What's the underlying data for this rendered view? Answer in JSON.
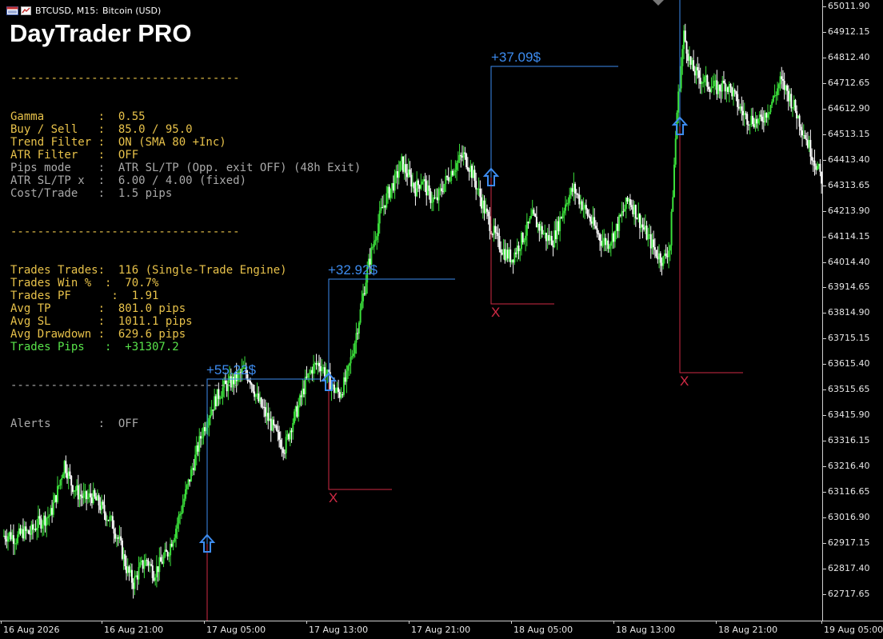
{
  "window": {
    "symbol": "BTCUSD, M15:",
    "description": "Bitcoin (USD)"
  },
  "panel": {
    "title": "DayTrader PRO",
    "separator": "----------------------------------",
    "rows_a": [
      {
        "key": "gamma",
        "text": "Gamma        :  0.55",
        "color": "yellow"
      },
      {
        "key": "buy-sell",
        "text": "Buy / Sell   :  85.0 / 95.0",
        "color": "yellow"
      },
      {
        "key": "trend-filter",
        "text": "Trend Filter :  ON (SMA 80 +Inc)",
        "color": "yellow"
      },
      {
        "key": "atr-filter",
        "text": "ATR Filter   :  OFF",
        "color": "yellow"
      },
      {
        "key": "pips-mode",
        "text": "Pips mode    :  ATR SL/TP (Opp. exit OFF) (48h Exit)",
        "color": "gray"
      },
      {
        "key": "atr-sltp",
        "text": "ATR SL/TP x  :  6.00 / 4.00 (fixed)",
        "color": "gray"
      },
      {
        "key": "cost-trade",
        "text": "Cost/Trade   :  1.5 pips",
        "color": "gray"
      }
    ],
    "rows_b": [
      {
        "key": "trades-trades",
        "text": "Trades Trades:  116 (Single-Trade Engine)",
        "color": "yellow"
      },
      {
        "key": "trades-win",
        "text": "Trades Win %  :  70.7%",
        "color": "yellow"
      },
      {
        "key": "trades-pf",
        "text": "Trades PF      :  1.91",
        "color": "yellow"
      },
      {
        "key": "avg-tp",
        "text": "Avg TP       :  801.0 pips",
        "color": "yellow"
      },
      {
        "key": "avg-sl",
        "text": "Avg SL       :  1011.1 pips",
        "color": "yellow"
      },
      {
        "key": "avg-drawdown",
        "text": "Avg Drawdown :  629.6 pips",
        "color": "yellow"
      },
      {
        "key": "trades-pips",
        "text": "Trades Pips   :  +31307.2",
        "color": "green"
      }
    ],
    "rows_c": [
      {
        "key": "alerts",
        "text": "Alerts       :  OFF",
        "color": "gray"
      }
    ]
  },
  "price_axis": [
    "65011.90",
    "64912.15",
    "64812.40",
    "64712.65",
    "64612.90",
    "64513.15",
    "64413.40",
    "64313.65",
    "64213.90",
    "64114.15",
    "64014.40",
    "63914.65",
    "63814.90",
    "63715.15",
    "63615.40",
    "63515.65",
    "63415.90",
    "63316.15",
    "63216.40",
    "63116.65",
    "63016.90",
    "62917.15",
    "62817.40",
    "62717.65"
  ],
  "time_axis": [
    "16 Aug 2026",
    "16 Aug 21:00",
    "17 Aug 05:00",
    "17 Aug 13:00",
    "17 Aug 21:00",
    "18 Aug 05:00",
    "18 Aug 13:00",
    "18 Aug 21:00",
    "19 Aug 05:00"
  ],
  "trades": [
    {
      "entry_time_index": 2.0,
      "profit": "+55.22$"
    },
    {
      "entry_time_index": 3.2,
      "profit": "+32.92$"
    },
    {
      "entry_time_index": 4.8,
      "profit": "+37.09$"
    },
    {
      "entry_time_index": 6.6,
      "profit": ""
    }
  ],
  "sl_marker": "X",
  "colors": {
    "bull_candle": "#3be03b",
    "bear_candle": "#ffffff",
    "tp_line": "#3d8cf0",
    "sl_line": "#d12a45",
    "panel_yellow": "#e8c24a",
    "panel_gray": "#a9a9a9",
    "panel_green": "#58e34a"
  },
  "chart_data": {
    "type": "candlestick",
    "symbol": "BTCUSD",
    "timeframe": "M15",
    "ylim": [
      62660,
      65030
    ],
    "close_series": [
      62945,
      62950,
      62935,
      62960,
      62955,
      62990,
      63010,
      63030,
      63120,
      63230,
      63150,
      63110,
      63090,
      63100,
      63070,
      63030,
      62990,
      62920,
      62820,
      62760,
      62820,
      62850,
      62800,
      62840,
      62880,
      62960,
      63050,
      63150,
      63250,
      63350,
      63420,
      63480,
      63520,
      63540,
      63560,
      63590,
      63560,
      63480,
      63430,
      63380,
      63330,
      63290,
      63380,
      63450,
      63540,
      63600,
      63620,
      63580,
      63520,
      63500,
      63560,
      63680,
      63820,
      63980,
      64100,
      64210,
      64280,
      64330,
      64400,
      64350,
      64300,
      64340,
      64270,
      64250,
      64310,
      64360,
      64400,
      64430,
      64380,
      64300,
      64220,
      64150,
      64090,
      64050,
      64030,
      64080,
      64130,
      64190,
      64150,
      64110,
      64100,
      64180,
      64260,
      64300,
      64250,
      64200,
      64150,
      64100,
      64090,
      64130,
      64200,
      64260,
      64210,
      64150,
      64100,
      64050,
      64020,
      64080,
      64600,
      64900,
      64780,
      64740,
      64720,
      64700,
      64690,
      64710,
      64680,
      64620,
      64580,
      64570,
      64560,
      64600,
      64650,
      64720,
      64680,
      64620,
      64550,
      64480,
      64410,
      64340
    ]
  }
}
